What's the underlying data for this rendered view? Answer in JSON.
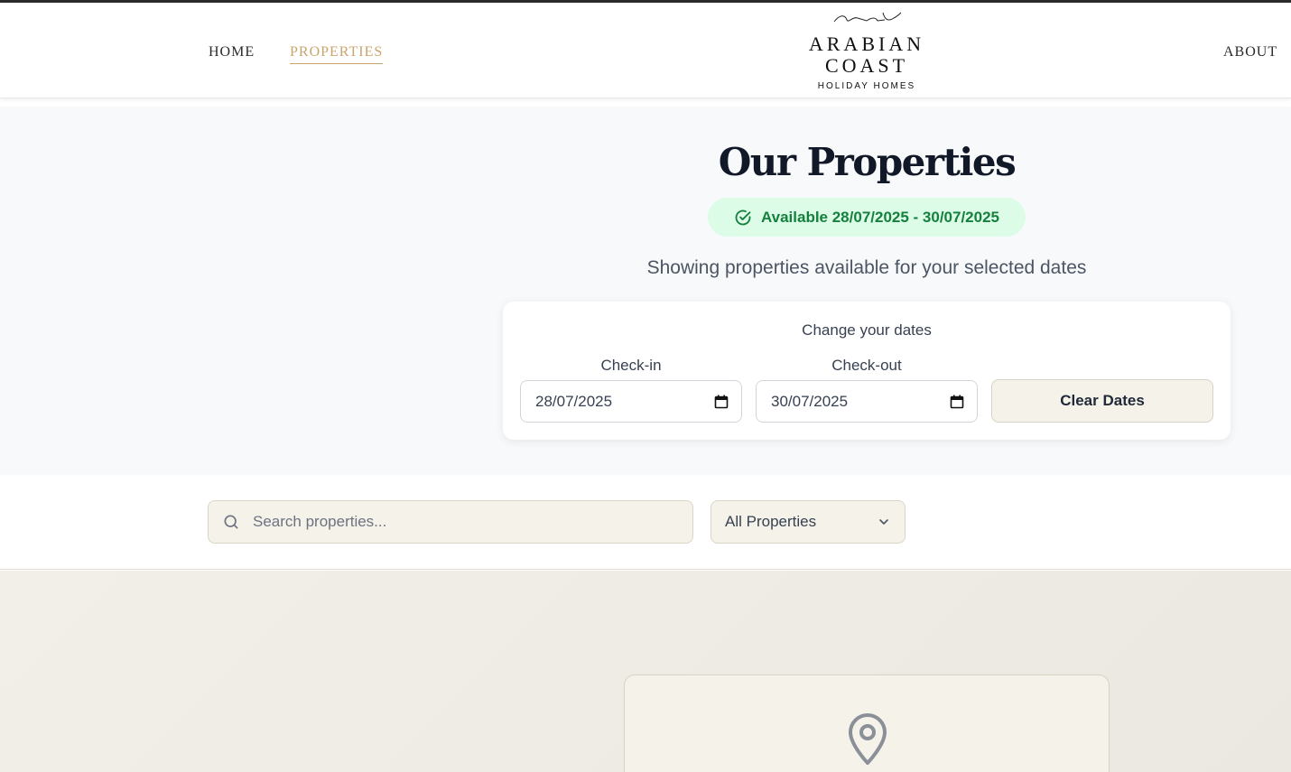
{
  "nav": {
    "home": "HOME",
    "properties": "PROPERTIES",
    "about": "ABOUT"
  },
  "logo": {
    "line1": "ARABIAN",
    "line2": "COAST",
    "line3": "HOLIDAY HOMES"
  },
  "hero": {
    "title": "Our Properties",
    "badge": "Available 28/07/2025 - 30/07/2025",
    "subtitle": "Showing properties available for your selected dates"
  },
  "dates": {
    "title": "Change your dates",
    "checkin_label": "Check-in",
    "checkout_label": "Check-out",
    "checkin_value": "28/07/2025",
    "checkout_value": "30/07/2025",
    "clear_label": "Clear Dates"
  },
  "filters": {
    "search_placeholder": "Search properties...",
    "type_selected": "All Properties"
  },
  "icons": {
    "badge": "check-circle-icon",
    "calendar": "calendar-icon",
    "search": "search-icon",
    "chevron": "chevron-down-icon",
    "pin": "map-pin-icon"
  },
  "colors": {
    "accent": "#c9a46c",
    "badge_bg": "#dcfce7",
    "badge_text": "#15803d",
    "cream": "#f5f2ea"
  }
}
